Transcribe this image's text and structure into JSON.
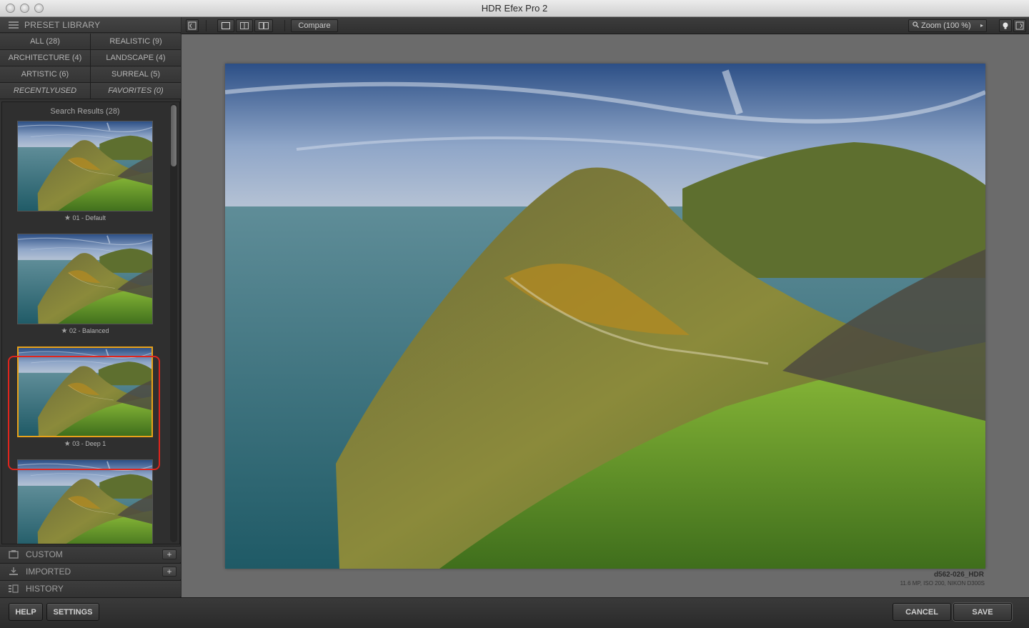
{
  "window": {
    "title": "HDR Efex Pro 2"
  },
  "preset_library": {
    "header": "PRESET LIBRARY",
    "filters": [
      {
        "label": "ALL (28)",
        "style": "normal"
      },
      {
        "label": "REALISTIC (9)",
        "style": "normal"
      },
      {
        "label": "ARCHITECTURE (4)",
        "style": "normal"
      },
      {
        "label": "LANDSCAPE (4)",
        "style": "normal"
      },
      {
        "label": "ARTISTIC (6)",
        "style": "normal"
      },
      {
        "label": "SURREAL (5)",
        "style": "normal"
      },
      {
        "label": "RECENTLYUSED",
        "style": "italic"
      },
      {
        "label": "FAVORITES (0)",
        "style": "italic"
      }
    ],
    "results_label": "Search Results (28)",
    "presets": [
      {
        "label": "01 - Default",
        "icon": "star-icon"
      },
      {
        "label": "02 - Balanced",
        "icon": "star-icon"
      },
      {
        "label": "03 - Deep 1",
        "icon": "star-icon",
        "selected": true
      },
      {
        "label": "",
        "icon": "star-icon"
      }
    ],
    "sections": [
      {
        "label": "CUSTOM",
        "icon": "custom-icon",
        "has_add": true
      },
      {
        "label": "IMPORTED",
        "icon": "import-icon",
        "has_add": true
      },
      {
        "label": "HISTORY",
        "icon": "history-icon",
        "has_add": false
      }
    ],
    "selection_color": "#e0251d",
    "thumb_selected_border": "#e8a21a"
  },
  "toolbar": {
    "compare_label": "Compare",
    "zoom_label": "Zoom (100 %)"
  },
  "image": {
    "filename": "d562-026_HDR",
    "info": "11.6 MP, ISO 200, NIKON D300S"
  },
  "footer": {
    "help_label": "HELP",
    "settings_label": "SETTINGS",
    "cancel_label": "CANCEL",
    "save_label": "SAVE"
  }
}
